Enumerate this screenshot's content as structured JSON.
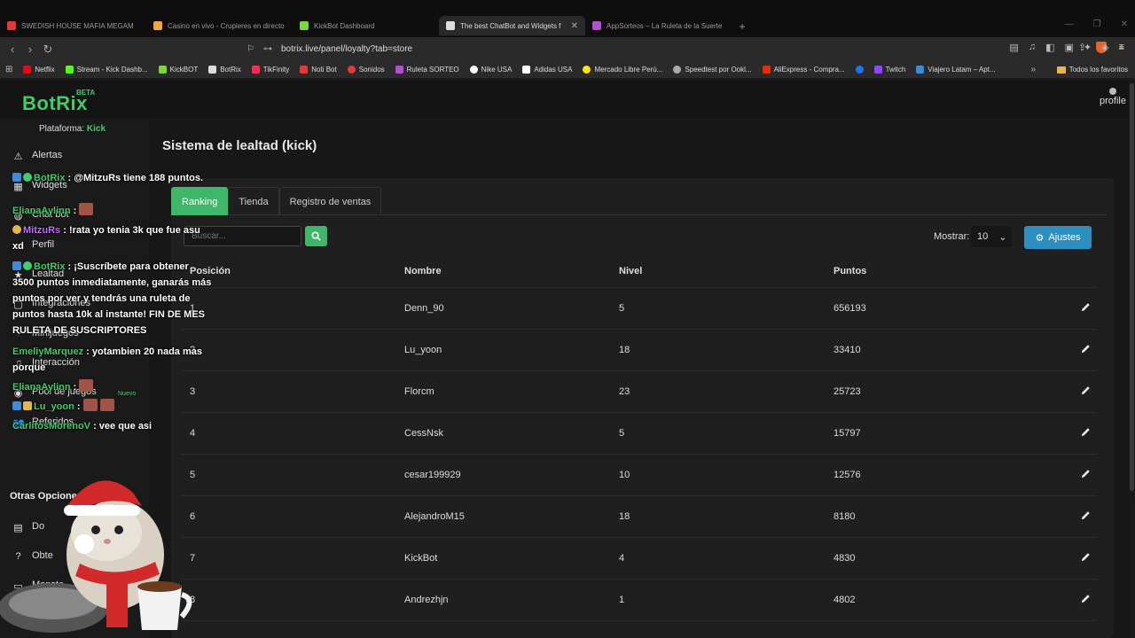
{
  "browser": {
    "tabs": [
      {
        "label": "SWEDISH HOUSE MAFIA MEGAM",
        "color": "#e53935",
        "active": false
      },
      {
        "label": "Casino en vivo - Crupieres en directo",
        "color": "#f2a93b",
        "active": false
      },
      {
        "label": "KickBot Dashboard",
        "color": "#7bd63a",
        "active": false
      },
      {
        "label": "The best ChatBot and Widgets f",
        "color": "#dddddd",
        "active": true
      },
      {
        "label": "AppSorteos – La Ruleta de la Suerte",
        "color": "#b44fd0",
        "active": false
      }
    ],
    "url": "botrix.live/panel/loyalty?tab=store",
    "bookmarks": [
      {
        "label": "Netflix",
        "color": "#e50914"
      },
      {
        "label": "Stream - Kick Dashb...",
        "color": "#53fc18"
      },
      {
        "label": "KickBOT",
        "color": "#7bd63a"
      },
      {
        "label": "BotRix",
        "color": "#dddddd"
      },
      {
        "label": "TikFinity",
        "color": "#fe2c55"
      },
      {
        "label": "Noti Bot",
        "color": "#e53935"
      },
      {
        "label": "Sonidos",
        "color": "#e53935"
      },
      {
        "label": "Ruleta SORTEO",
        "color": "#b44fd0"
      },
      {
        "label": "Nike USA",
        "color": "#ffffff"
      },
      {
        "label": "Adidas USA",
        "color": "#ffffff"
      },
      {
        "label": "Mercado Libre Perú...",
        "color": "#ffe600"
      },
      {
        "label": "Speedtest por Ookl...",
        "color": "#aaaaaa"
      },
      {
        "label": "AliExpress - Compra...",
        "color": "#e62e04"
      },
      {
        "label": "",
        "color": "#1877f2"
      },
      {
        "label": "Twitch",
        "color": "#9146ff"
      },
      {
        "label": "Viajero Latam – Apt...",
        "color": "#3d8bd9"
      }
    ],
    "favorites_label": "Todos los favoritos"
  },
  "app": {
    "logo": "BotRix",
    "beta": "BETA",
    "profile_label": "profile",
    "platform_label": "Plataforma:",
    "platform_value": "Kick",
    "sidebar": {
      "items": [
        {
          "label": "Alertas",
          "icon": "warning-icon"
        },
        {
          "label": "Widgets",
          "icon": "widgets-icon"
        },
        {
          "label": "Chat bot",
          "icon": "chat-bot-icon"
        },
        {
          "label": "Perfil",
          "icon": "profile-icon"
        },
        {
          "label": "Lealtad",
          "icon": "loyalty-icon"
        },
        {
          "label": "Integraciones",
          "icon": "integrations-icon"
        },
        {
          "label": "Minijuegos",
          "icon": "minigames-icon"
        },
        {
          "label": "Interacción",
          "icon": "music-icon"
        },
        {
          "label": "Pool de juegos",
          "icon": "pool-icon"
        },
        {
          "label": "Referidos",
          "icon": "users-icon"
        }
      ],
      "nuevo": "Nuevo",
      "section_title": "Otras Opciones",
      "other": [
        {
          "label": "Do",
          "icon": "document-icon"
        },
        {
          "label": "Obte",
          "icon": "help-icon"
        },
        {
          "label": "Monste",
          "icon": "monitor-icon"
        }
      ]
    },
    "chat": [
      {
        "user": "BotRix",
        "color": "#3fcf6a",
        "text": ": @MitzuRs tiene 188 puntos."
      },
      {
        "user": "ElianaAylinn",
        "color": "#3fcf6a",
        "text": ":"
      },
      {
        "user": "MitzuRs",
        "color": "#c26bff",
        "text": ": !rata yo tenia 3k que fue asu xd"
      },
      {
        "user": "BotRix",
        "color": "#3fcf6a",
        "text": ": ¡Suscríbete para obtener 3500 puntos inmediatamente, ganarás más puntos por ver y tendrás una ruleta de puntos hasta 10k al instante! FIN DE MES RULETA DE SUSCRIPTORES"
      },
      {
        "user": "EmeliyMarquez",
        "color": "#3fcf6a",
        "text": ": yotambien 20 nada mas porque"
      },
      {
        "user": "ElianaAylinn",
        "color": "#3fcf6a",
        "text": ":"
      },
      {
        "user": "Lu_yoon",
        "color": "#3fcf6a",
        "text": ":"
      },
      {
        "user": "CarlitosMorenoV",
        "color": "#3fcf6a",
        "text": ": vee que asi"
      }
    ],
    "page_title": "Sistema de lealtad (kick)",
    "tabs": [
      "Ranking",
      "Tienda",
      "Registro de ventas"
    ],
    "search_placeholder": "Buscar...",
    "mostrar_label": "Mostrar:",
    "mostrar_value": "10",
    "ajustes_label": "Ajustes",
    "table": {
      "headers": [
        "Posición",
        "Nombre",
        "Nivel",
        "Puntos"
      ],
      "rows": [
        {
          "pos": "1",
          "name": "Denn_90",
          "level": "5",
          "points": "656193"
        },
        {
          "pos": "2",
          "name": "Lu_yoon",
          "level": "18",
          "points": "33410"
        },
        {
          "pos": "3",
          "name": "Florcm",
          "level": "23",
          "points": "25723"
        },
        {
          "pos": "4",
          "name": "CessNsk",
          "level": "5",
          "points": "15797"
        },
        {
          "pos": "5",
          "name": "cesar199929",
          "level": "10",
          "points": "12576"
        },
        {
          "pos": "6",
          "name": "AlejandroM15",
          "level": "18",
          "points": "8180"
        },
        {
          "pos": "7",
          "name": "KickBot",
          "level": "4",
          "points": "4830"
        },
        {
          "pos": "8",
          "name": "Andrezhjn",
          "level": "1",
          "points": "4802"
        }
      ]
    }
  }
}
